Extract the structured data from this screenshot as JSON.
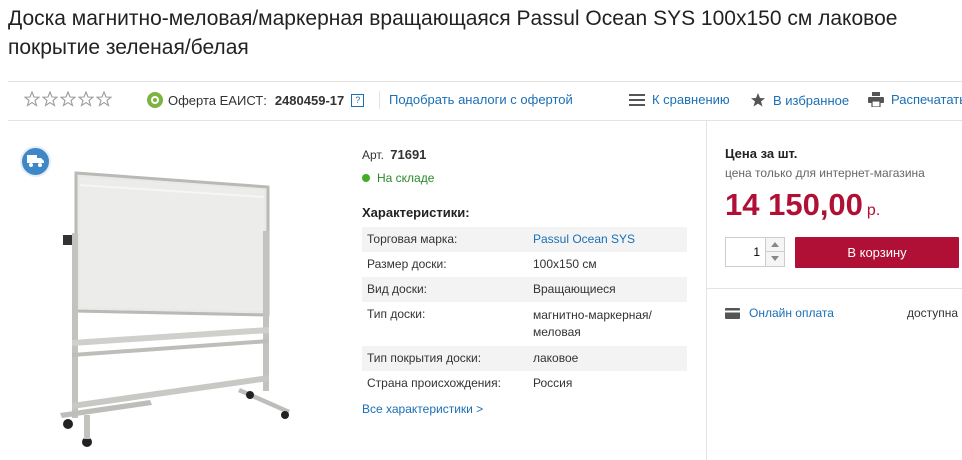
{
  "product": {
    "title": "Доска магнитно-меловая/маркерная вращающаяся Passul Ocean SYS 100x150 см лаковое покрытие зеленая/белая"
  },
  "toolbar": {
    "rating_stars": 5,
    "offer_label": "Оферта ЕАИСТ:",
    "offer_number": "2480459-17",
    "help_label": "?",
    "analogs_link": "Подобрать аналоги с офертой",
    "compare_label": "К сравнению",
    "favorite_label": "В избранное",
    "print_label": "Распечатать"
  },
  "details": {
    "art_label": "Арт.",
    "art_value": "71691",
    "stock_status": "На складе",
    "characteristics_title": "Характеристики:",
    "characteristics": [
      {
        "key": "Торговая марка:",
        "value": "Passul Ocean SYS",
        "is_link": true
      },
      {
        "key": "Размер доски:",
        "value": "100х150 см"
      },
      {
        "key": "Вид доски:",
        "value": "Вращающиеся"
      },
      {
        "key": "Тип доски:",
        "value": "магнитно-маркерная/ меловая"
      },
      {
        "key": "Тип покрытия доски:",
        "value": "лаковое"
      },
      {
        "key": "Страна происхождения:",
        "value": "Россия"
      }
    ],
    "all_characteristics_link": "Все характеристики >"
  },
  "buy": {
    "price_header": "Цена за шт.",
    "price_note": "цена только для интернет-магазина",
    "price_value": "14 150,00",
    "price_currency": "р.",
    "quantity": "1",
    "cart_button": "В корзину",
    "online_pay_label": "Онлайн оплата",
    "online_pay_status": "доступна"
  },
  "colors": {
    "accent": "#b01035",
    "link": "#1a6fb5",
    "in_stock": "#3fae29"
  }
}
